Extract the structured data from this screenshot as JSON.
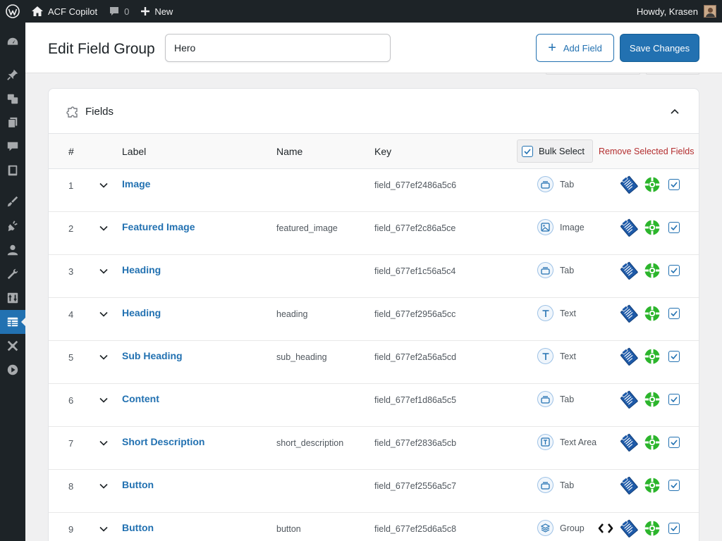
{
  "adminbar": {
    "site_name": "ACF Copilot",
    "comments_count": "0",
    "new_label": "New",
    "howdy": "Howdy, Krasen"
  },
  "sidebar": {
    "items": [
      {
        "icon": "dashboard-icon"
      },
      {
        "icon": "pin-icon"
      },
      {
        "icon": "media-icon"
      },
      {
        "icon": "pages-icon"
      },
      {
        "icon": "comments-icon"
      },
      {
        "icon": "book-icon"
      },
      {
        "icon": "brush-icon"
      },
      {
        "icon": "plugins-icon"
      },
      {
        "icon": "users-icon"
      },
      {
        "icon": "tools-icon"
      },
      {
        "icon": "settings-icon"
      },
      {
        "icon": "acf-icon",
        "active": true
      },
      {
        "icon": "plane-icon"
      },
      {
        "icon": "play-icon"
      }
    ]
  },
  "header": {
    "title": "Edit Field Group",
    "group_name_value": "Hero",
    "add_field_label": "Add Field",
    "save_label": "Save Changes"
  },
  "panel": {
    "title": "Fields",
    "columns": {
      "num": "#",
      "label": "Label",
      "name": "Name",
      "key": "Key"
    },
    "bulk_select_label": "Bulk Select",
    "remove_selected_label": "Remove Selected Fields"
  },
  "fields": [
    {
      "num": "1",
      "label": "Image",
      "name": "",
      "key": "field_677ef2486a5c6",
      "type": "Tab",
      "type_icon": "tab-icon"
    },
    {
      "num": "2",
      "label": "Featured Image",
      "name": "featured_image",
      "key": "field_677ef2c86a5ce",
      "type": "Image",
      "type_icon": "image-icon"
    },
    {
      "num": "3",
      "label": "Heading",
      "name": "",
      "key": "field_677ef1c56a5c4",
      "type": "Tab",
      "type_icon": "tab-icon"
    },
    {
      "num": "4",
      "label": "Heading",
      "name": "heading",
      "key": "field_677ef2956a5cc",
      "type": "Text",
      "type_icon": "text-icon"
    },
    {
      "num": "5",
      "label": "Sub Heading",
      "name": "sub_heading",
      "key": "field_677ef2a56a5cd",
      "type": "Text",
      "type_icon": "text-icon"
    },
    {
      "num": "6",
      "label": "Content",
      "name": "",
      "key": "field_677ef1d86a5c5",
      "type": "Tab",
      "type_icon": "tab-icon"
    },
    {
      "num": "7",
      "label": "Short Description",
      "name": "short_description",
      "key": "field_677ef2836a5cb",
      "type": "Text Area",
      "type_icon": "textarea-icon"
    },
    {
      "num": "8",
      "label": "Button",
      "name": "",
      "key": "field_677ef2556a5c7",
      "type": "Tab",
      "type_icon": "tab-icon"
    },
    {
      "num": "9",
      "label": "Button",
      "name": "button",
      "key": "field_677ef25d6a5c8",
      "type": "Group",
      "type_icon": "group-icon",
      "has_code_icon": true
    }
  ],
  "colors": {
    "accent": "#2271b1",
    "admin_dark": "#1d2327",
    "danger": "#b32d2e",
    "ring_green": "#2cb52c"
  }
}
